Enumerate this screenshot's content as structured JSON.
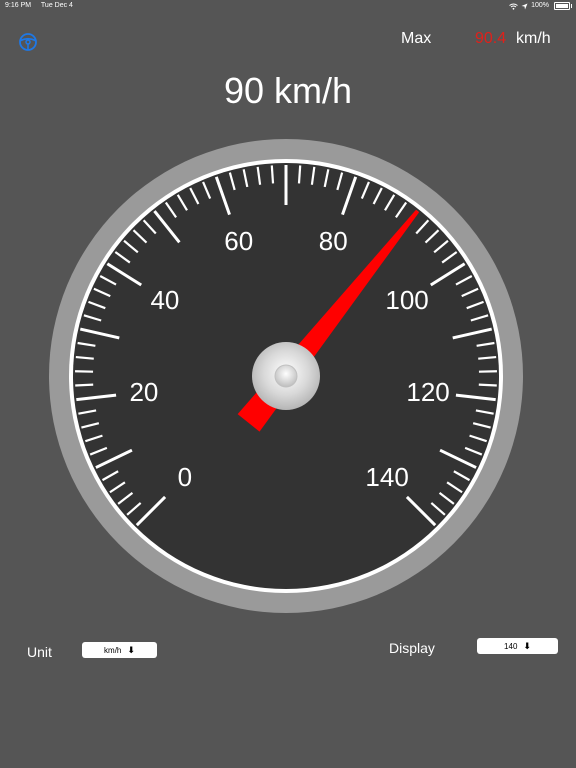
{
  "status_bar": {
    "time": "9:16 PM",
    "date": "Tue Dec 4",
    "battery": "100%"
  },
  "header": {
    "settings_icon": "steering-wheel-icon",
    "max_label": "Max",
    "max_value": "90.4",
    "max_unit": "km/h"
  },
  "speed": {
    "value": 90,
    "unit": "km/h",
    "display": "90 km/h"
  },
  "gauge": {
    "min": 0,
    "max": 140,
    "labels": [
      "0",
      "20",
      "40",
      "60",
      "80",
      "100",
      "120",
      "140"
    ],
    "needle_value": 90,
    "needle_color": "#ff0000",
    "dial_color": "#333333",
    "bezel_color": "#9a9a9a"
  },
  "controls": {
    "unit_label": "Unit",
    "unit_value": "km/h",
    "display_label": "Display",
    "display_value": "140"
  },
  "colors": {
    "background": "#555555",
    "max_value": "#e0201a"
  }
}
